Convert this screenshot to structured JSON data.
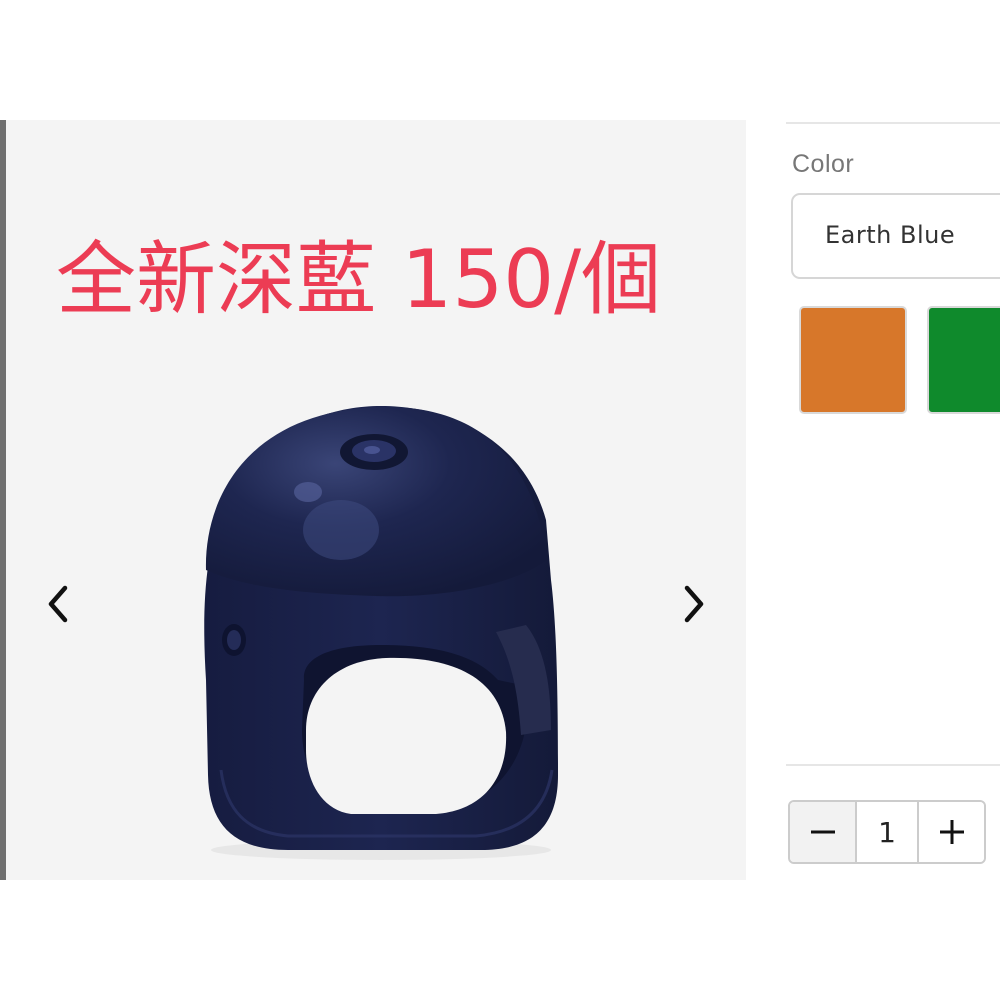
{
  "gallery": {
    "overlay_text": "全新深藍 150/個",
    "overlay_color": "#ec3c54",
    "image_subject": "helmet",
    "image_color": "#1b2349",
    "background": "#f4f4f4",
    "prev_icon": "chevron-left-icon",
    "next_icon": "chevron-right-icon"
  },
  "options": {
    "color_label": "Color",
    "selected_color": "Earth Blue",
    "swatches": [
      {
        "name": "orange",
        "hex": "#d7772a"
      },
      {
        "name": "green",
        "hex": "#0f8a2c"
      }
    ]
  },
  "quantity": {
    "minus_icon": "minus-icon",
    "value": "1",
    "plus_icon": "plus-icon"
  }
}
